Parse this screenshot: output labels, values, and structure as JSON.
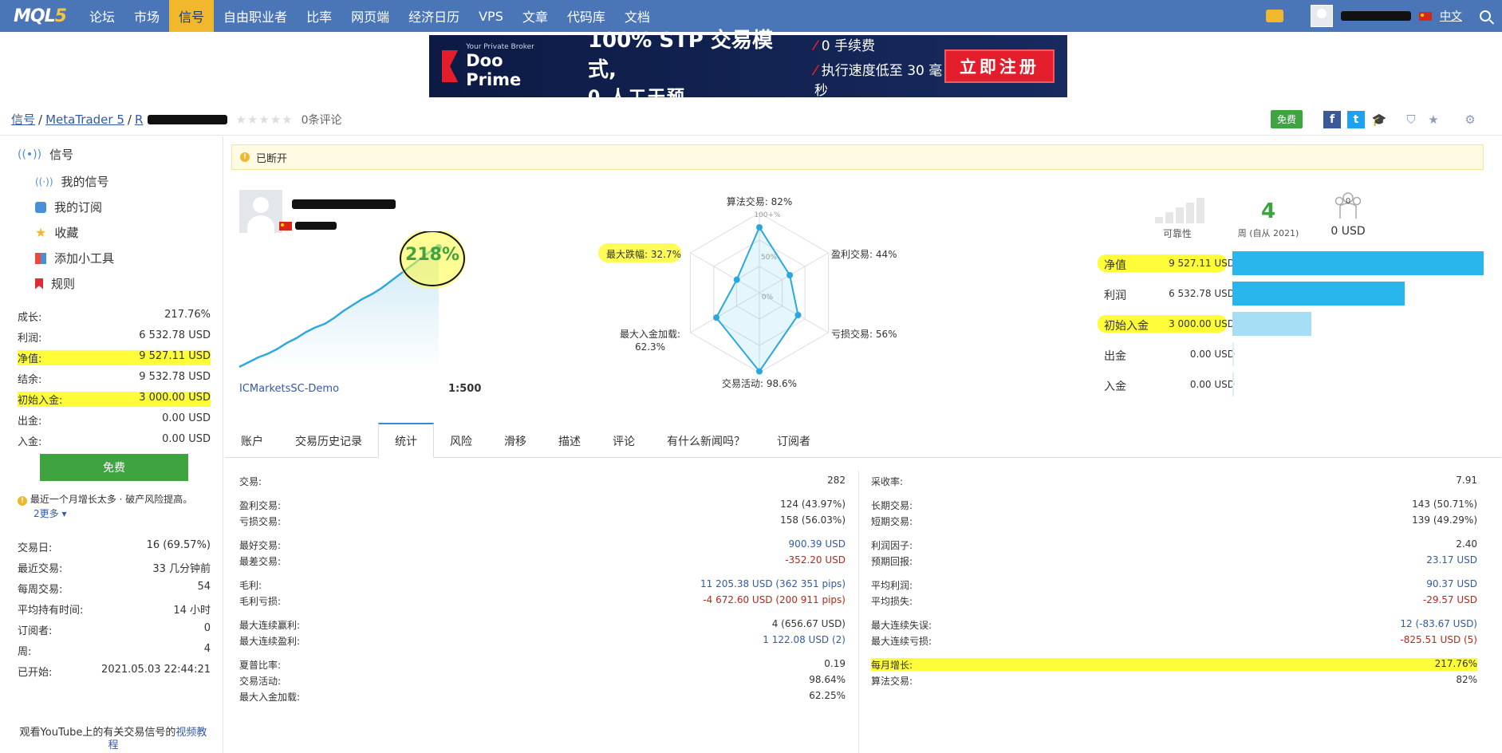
{
  "nav": {
    "logo_a": "MQL",
    "logo_b": "5",
    "items": [
      "论坛",
      "市场",
      "信号",
      "自由职业者",
      "比率",
      "网页端",
      "经济日历",
      "VPS",
      "文章",
      "代码库",
      "文档"
    ],
    "active": "信号",
    "lang": "中文"
  },
  "banner": {
    "tagline": "Your Private Broker",
    "brand": "Doo Prime",
    "line1": "100% STP 交易模式,",
    "line2": "0 人工干预",
    "feat1": "0 手续费",
    "feat2": "执行速度低至 30 毫秒",
    "cta": "立即注册"
  },
  "breadcrumb": {
    "a": "信号",
    "b": "MetaTrader 5",
    "c": "R",
    "stars": "★★★★★",
    "reviews": "0条评论"
  },
  "actions": {
    "free": "免费",
    "fb": "f",
    "tw": "t"
  },
  "sidebar": {
    "head": "信号",
    "menu": [
      "我的信号",
      "我的订阅",
      "收藏",
      "添加小工具",
      "规则"
    ],
    "stats": [
      {
        "k": "成长:",
        "v": "217.76%"
      },
      {
        "k": "利润:",
        "v": "6 532.78 USD"
      },
      {
        "k": "净值:",
        "v": "9 527.11 USD"
      },
      {
        "k": "结余:",
        "v": "9 532.78 USD"
      },
      {
        "k": "初始入金:",
        "v": "3 000.00 USD"
      },
      {
        "k": "出金:",
        "v": "0.00 USD"
      },
      {
        "k": "入金:",
        "v": "0.00 USD"
      }
    ],
    "free_button": "免费",
    "warning": "最近一个月增长太多 · 破产风险提高。",
    "more": "2更多 ▾",
    "stats2": [
      {
        "k": "交易日:",
        "v": "16 (69.57%)"
      },
      {
        "k": "最近交易:",
        "v": "33 几分钟前"
      },
      {
        "k": "每周交易:",
        "v": "54"
      },
      {
        "k": "平均持有时间:",
        "v": "14 小时"
      },
      {
        "k": "订阅者:",
        "v": "0"
      },
      {
        "k": "周:",
        "v": "4"
      },
      {
        "k": "已开始:",
        "v": "2021.05.03 22:44:21"
      }
    ],
    "footer_text": "观看YouTube上的有关交易信号的",
    "footer_link": "视频教程"
  },
  "main": {
    "status": "已断开",
    "growth": "218%",
    "server": "ICMarketsSC-Demo",
    "leverage": "1:500",
    "reliability_label": "可靠性",
    "weeks": "4",
    "weeks_label": "周 (自从 2021)",
    "subs_count": "0",
    "subs_value": "0 USD"
  },
  "radar": {
    "top": "算法交易: 82%",
    "right_top": "盈利交易: 44%",
    "right_bottom": "亏损交易: 56%",
    "bottom": "交易活动: 98.6%",
    "left_bottom_1": "最大入金加载:",
    "left_bottom_2": "62.3%",
    "left_top": "最大跌幅: 32.7%",
    "ring100": "100+%",
    "ring50": "50%",
    "ring0": "0%",
    "values": [
      82,
      44,
      56,
      98.6,
      62.3,
      32.7
    ]
  },
  "bars": [
    {
      "label": "净值",
      "value": "9 527.11 USD",
      "amount": 9527.11,
      "color": "#29b6ec"
    },
    {
      "label": "利润",
      "value": "6 532.78 USD",
      "amount": 6532.78,
      "color": "#29b6ec"
    },
    {
      "label": "初始入金",
      "value": "3 000.00 USD",
      "amount": 3000.0,
      "color": "#a6dff5"
    },
    {
      "label": "出金",
      "value": "0.00 USD",
      "amount": 0,
      "color": "#29b6ec"
    },
    {
      "label": "入金",
      "value": "0.00 USD",
      "amount": 0,
      "color": "#29b6ec"
    }
  ],
  "tabs": [
    "账户",
    "交易历史记录",
    "统计",
    "风险",
    "滑移",
    "描述",
    "评论",
    "有什么新闻吗？",
    "订阅者"
  ],
  "stats_left": [
    {
      "k": "交易:",
      "v": "282"
    },
    {
      "k": "盈利交易:",
      "v": "124 (43.97%)"
    },
    {
      "k": "亏损交易:",
      "v": "158 (56.03%)"
    },
    {
      "k": "最好交易:",
      "v": "900.39 USD"
    },
    {
      "k": "最差交易:",
      "v": "-352.20 USD"
    },
    {
      "k": "毛利:",
      "v": "11 205.38 USD (362 351 pips)"
    },
    {
      "k": "毛利亏损:",
      "v": "-4 672.60 USD (200 911 pips)"
    },
    {
      "k": "最大连续赢利:",
      "v": "4 (656.67 USD)"
    },
    {
      "k": "最大连续盈利:",
      "v": "1 122.08 USD (2)"
    },
    {
      "k": "夏普比率:",
      "v": "0.19"
    },
    {
      "k": "交易活动:",
      "v": "98.64%"
    },
    {
      "k": "最大入金加载:",
      "v": "62.25%"
    }
  ],
  "stats_right": [
    {
      "k": "采收率:",
      "v": "7.91"
    },
    {
      "k": "长期交易:",
      "v": "143 (50.71%)"
    },
    {
      "k": "短期交易:",
      "v": "139 (49.29%)"
    },
    {
      "k": "利润因子:",
      "v": "2.40"
    },
    {
      "k": "预期回报:",
      "v": "23.17 USD"
    },
    {
      "k": "平均利润:",
      "v": "90.37 USD"
    },
    {
      "k": "平均损失:",
      "v": "-29.57 USD"
    },
    {
      "k": "最大连续失误:",
      "v": "12 (-83.67 USD)"
    },
    {
      "k": "最大连续亏损:",
      "v": "-825.51 USD (5)"
    },
    {
      "k": "每月增长:",
      "v": "217.76%"
    },
    {
      "k": "算法交易:",
      "v": "82%"
    }
  ],
  "growth_curve": [
    0,
    4,
    8,
    11,
    15,
    20,
    24,
    29,
    33,
    36,
    41,
    47,
    52,
    57,
    61,
    66,
    72,
    78,
    84,
    90,
    96,
    100
  ]
}
